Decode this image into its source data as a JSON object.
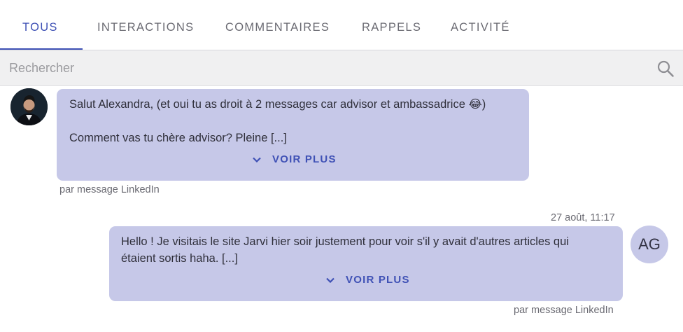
{
  "tabs": [
    {
      "label": "TOUS",
      "active": true
    },
    {
      "label": "INTERACTIONS",
      "active": false
    },
    {
      "label": "COMMENTAIRES",
      "active": false
    },
    {
      "label": "RAPPELS",
      "active": false
    },
    {
      "label": "ACTIVITÉ",
      "active": false
    }
  ],
  "search": {
    "placeholder": "Rechercher",
    "icon": "search-icon"
  },
  "messages": [
    {
      "lines": [
        "Salut Alexandra, (et oui tu as droit à 2 messages car advisor et ambassadrice 😂)",
        "",
        "Comment vas tu chère advisor? Pleine  [...]"
      ],
      "voir_plus": "VOIR PLUS",
      "source": "par message LinkedIn"
    },
    {
      "timestamp": "27 août, 11:17",
      "lines": [
        "Hello ! Je visitais le site Jarvi hier soir justement pour voir s'il y avait d'autres articles qui",
        "étaient sortis haha.  [...]"
      ],
      "voir_plus": "VOIR PLUS",
      "source": "par message LinkedIn",
      "avatar_initials": "AG"
    }
  ],
  "colors": {
    "accent": "#3f51b5",
    "bubble": "#c6c8e8",
    "search_bg": "#f0f0f1"
  }
}
